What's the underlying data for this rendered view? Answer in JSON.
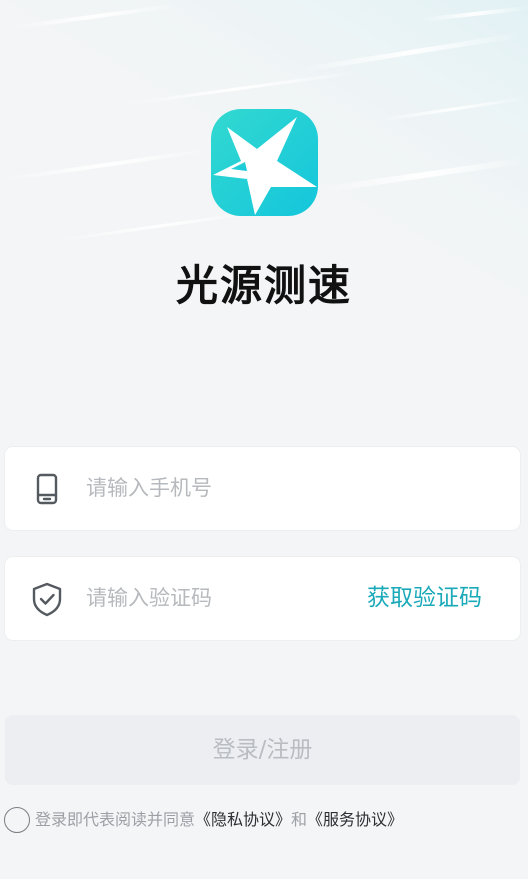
{
  "app": {
    "name": "光源测速",
    "logo_icon": "starburst-logo-icon",
    "accent_color": "#1aa9b9"
  },
  "phone_field": {
    "icon": "phone-icon",
    "placeholder": "请输入手机号"
  },
  "code_field": {
    "icon": "shield-check-icon",
    "placeholder": "请输入验证码",
    "get_code_label": "获取验证码"
  },
  "login": {
    "label": "登录/注册"
  },
  "agreement": {
    "prefix": "登录即代表阅读并同意",
    "privacy_link": "《隐私协议》",
    "conjunction": "和",
    "service_link": "《服务协议》"
  }
}
